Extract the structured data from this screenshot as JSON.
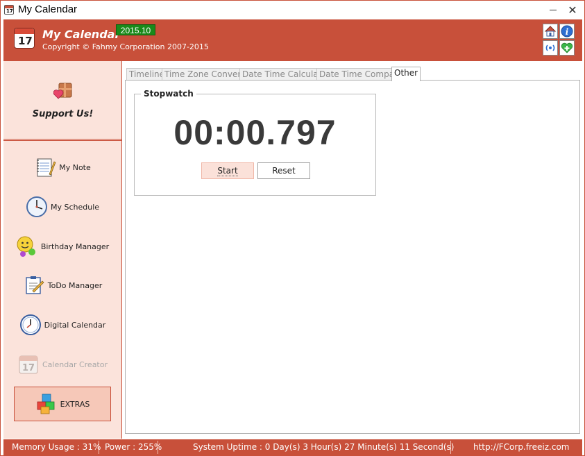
{
  "window": {
    "title": "My Calendar"
  },
  "header": {
    "app_name": "My Calendar",
    "version": "2015.10",
    "copyright": "Copyright © Fahmy Corporation 2007-2015",
    "logo_number": "17",
    "toolbar_icons": [
      "home-icon",
      "info-icon",
      "radio-icon",
      "health-plus-icon"
    ]
  },
  "sidebar": {
    "support_label": "Support Us!",
    "items": [
      {
        "label": "My Note",
        "icon": "notepad-icon"
      },
      {
        "label": "My Schedule",
        "icon": "clock-icon"
      },
      {
        "label": "Birthday Manager",
        "icon": "smiley-icon"
      },
      {
        "label": "ToDo Manager",
        "icon": "todo-icon"
      },
      {
        "label": "Digital Calendar",
        "icon": "digital-clock-icon"
      },
      {
        "label": "Calendar Creator",
        "icon": "calendar-icon"
      },
      {
        "label": "EXTRAS",
        "icon": "cubes-icon"
      }
    ],
    "calendar_icon_number": "17"
  },
  "tabs": [
    {
      "label": "Timeline"
    },
    {
      "label": "Time Zone Converter"
    },
    {
      "label": "Date Time Calculator"
    },
    {
      "label": "Date Time Comparer"
    },
    {
      "label": "Other"
    }
  ],
  "stopwatch": {
    "title": "Stopwatch",
    "time": "00:00.797",
    "start_label": "Start",
    "reset_label": "Reset"
  },
  "statusbar": {
    "memory": "Memory Usage : 31%",
    "power": "Power : 255%",
    "uptime": "System Uptime : 0 Day(s) 3 Hour(s) 27 Minute(s) 11 Second(s)",
    "url": "http://FCorp.freeiz.com"
  },
  "colors": {
    "accent": "#c8503a",
    "sidebar_bg": "#fbe3db",
    "version_badge": "#1a8a1a"
  }
}
